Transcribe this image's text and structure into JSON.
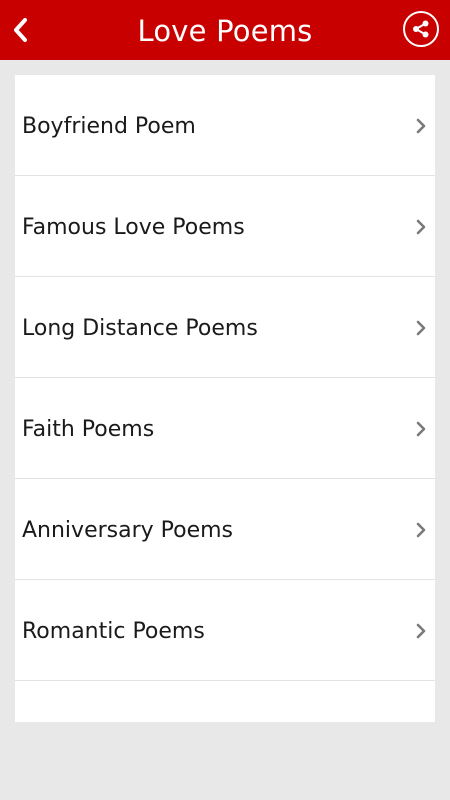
{
  "app_bar": {
    "title": "Love Poems",
    "background": "#c90000",
    "back_icon": "chevron-left-icon",
    "share_icon": "share-icon"
  },
  "list": {
    "items": [
      {
        "label": "Boyfriend Poem"
      },
      {
        "label": "Famous Love Poems"
      },
      {
        "label": "Long Distance Poems"
      },
      {
        "label": "Faith Poems"
      },
      {
        "label": "Anniversary Poems"
      },
      {
        "label": "Romantic Poems"
      }
    ],
    "item_icon": "chevron-right-icon"
  }
}
